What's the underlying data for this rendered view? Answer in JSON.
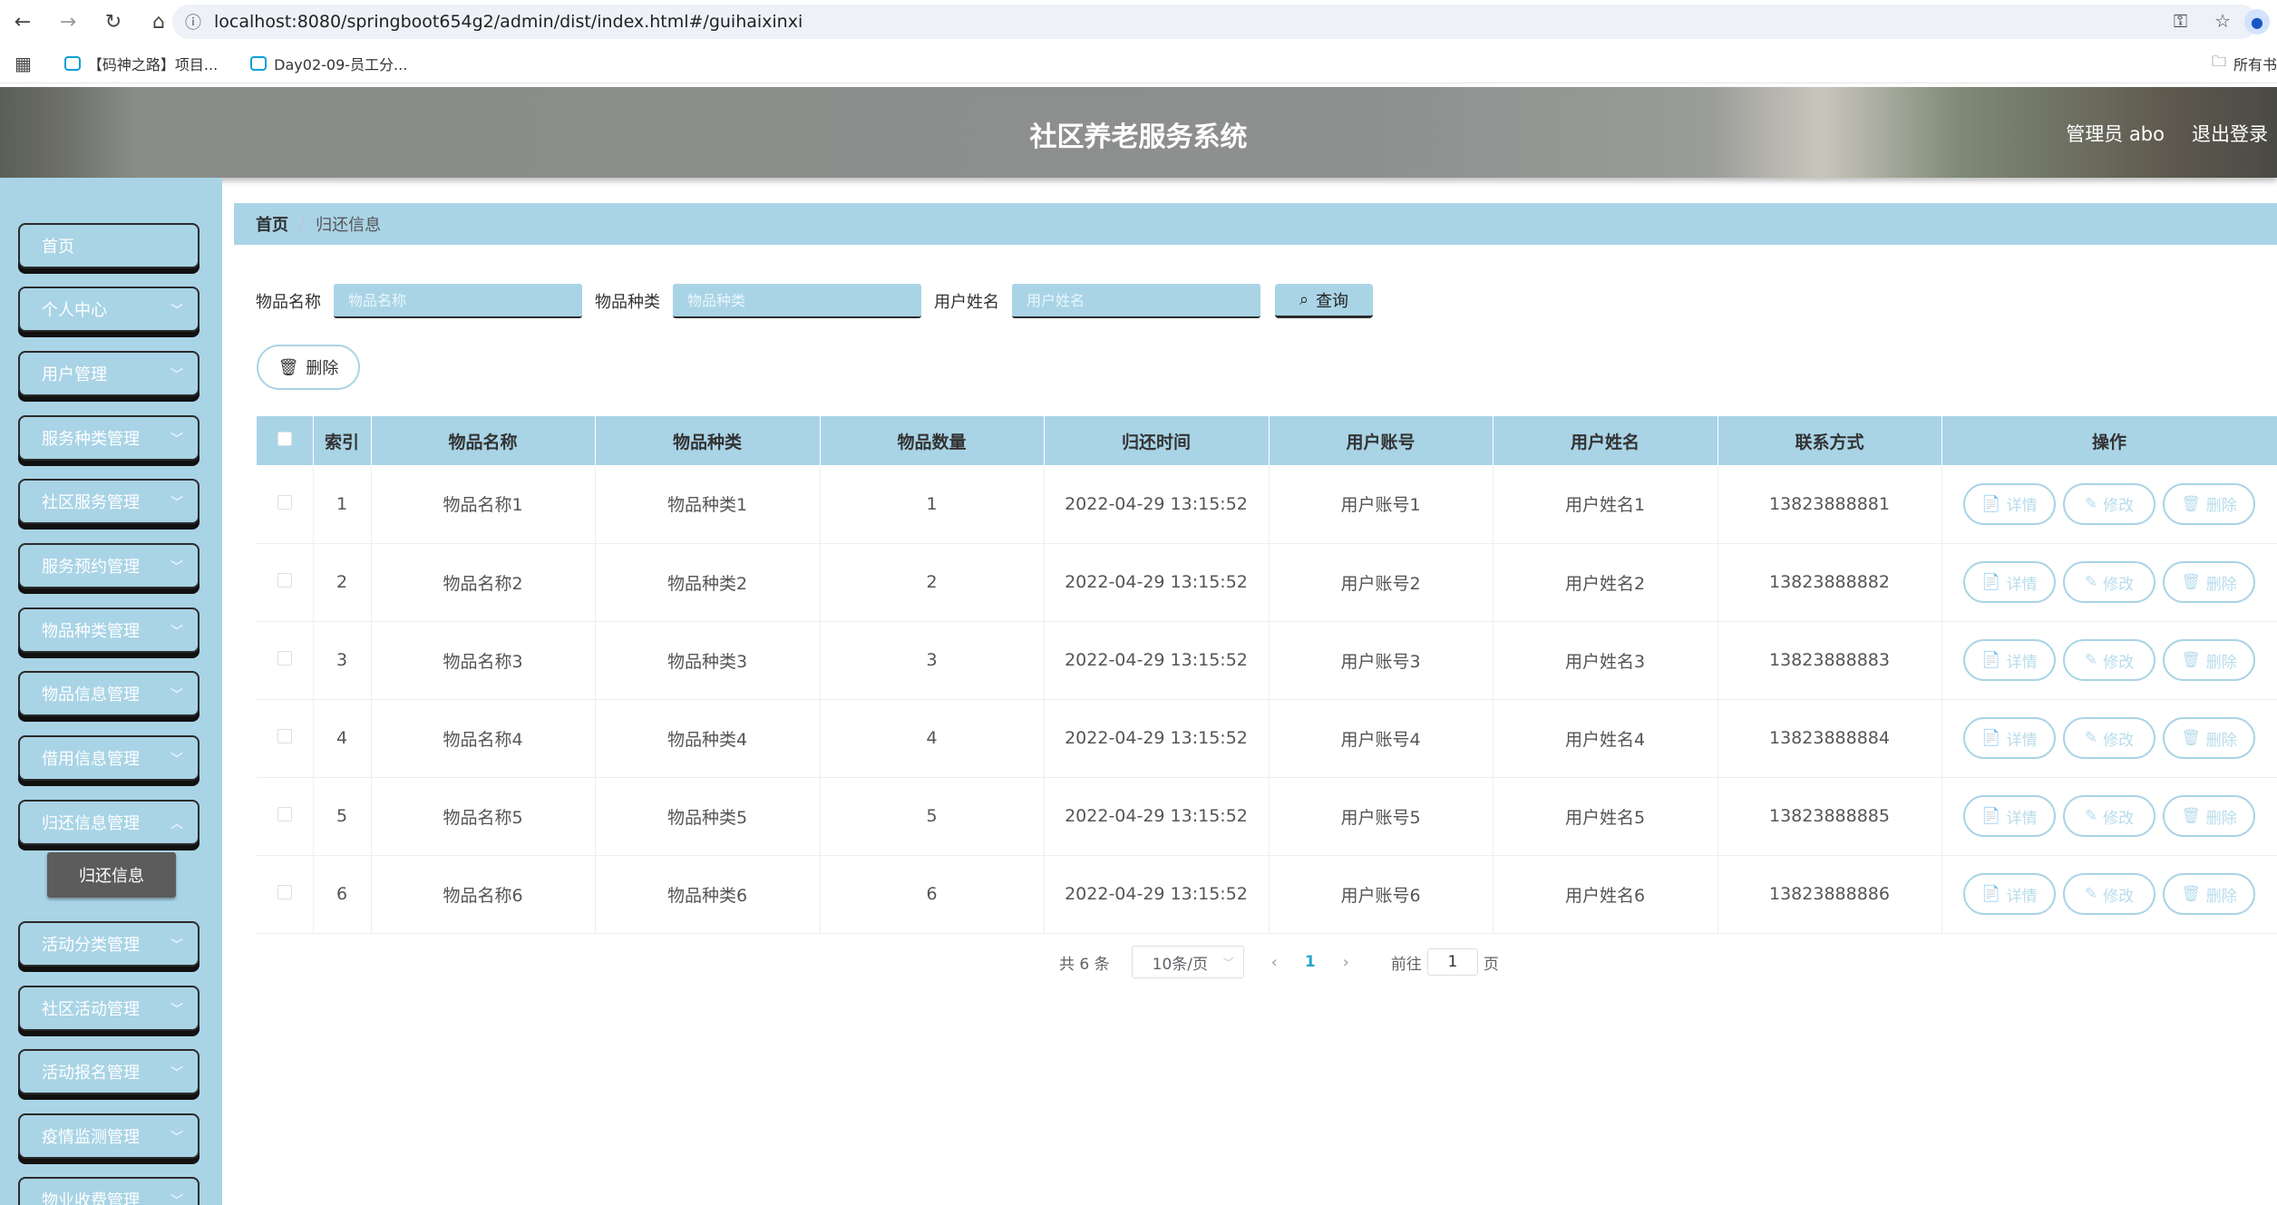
{
  "browser": {
    "url": "localhost:8080/springboot654g2/admin/dist/index.html#/guihaixinxi",
    "bookmarks": [
      "【码神之路】项目...",
      "Day02-09-员工分..."
    ],
    "bookmarks_right": "所有书"
  },
  "header": {
    "title": "社区养老服务系统",
    "user": "管理员 abo",
    "logout": "退出登录"
  },
  "sidebar": {
    "items": [
      {
        "label": "首页",
        "has_children": false
      },
      {
        "label": "个人中心",
        "has_children": true
      },
      {
        "label": "用户管理",
        "has_children": true
      },
      {
        "label": "服务种类管理",
        "has_children": true
      },
      {
        "label": "社区服务管理",
        "has_children": true
      },
      {
        "label": "服务预约管理",
        "has_children": true
      },
      {
        "label": "物品种类管理",
        "has_children": true
      },
      {
        "label": "物品信息管理",
        "has_children": true
      },
      {
        "label": "借用信息管理",
        "has_children": true
      },
      {
        "label": "归还信息管理",
        "has_children": true
      },
      {
        "label": "活动分类管理",
        "has_children": true
      },
      {
        "label": "社区活动管理",
        "has_children": true
      },
      {
        "label": "活动报名管理",
        "has_children": true
      },
      {
        "label": "疫情监测管理",
        "has_children": true
      },
      {
        "label": "物业收费管理",
        "has_children": true
      }
    ],
    "active_sub": "归还信息"
  },
  "breadcrumb": {
    "home": "首页",
    "current": "归还信息"
  },
  "search": {
    "fields": [
      {
        "label": "物品名称",
        "placeholder": "物品名称"
      },
      {
        "label": "物品种类",
        "placeholder": "物品种类"
      },
      {
        "label": "用户姓名",
        "placeholder": "用户姓名"
      }
    ],
    "query_label": "查询"
  },
  "toolbar": {
    "delete_label": "删除"
  },
  "table": {
    "columns": [
      "索引",
      "物品名称",
      "物品种类",
      "物品数量",
      "归还时间",
      "用户账号",
      "用户姓名",
      "联系方式",
      "操作"
    ],
    "rows": [
      [
        "1",
        "物品名称1",
        "物品种类1",
        "1",
        "2022-04-29 13:15:52",
        "用户账号1",
        "用户姓名1",
        "13823888881"
      ],
      [
        "2",
        "物品名称2",
        "物品种类2",
        "2",
        "2022-04-29 13:15:52",
        "用户账号2",
        "用户姓名2",
        "13823888882"
      ],
      [
        "3",
        "物品名称3",
        "物品种类3",
        "3",
        "2022-04-29 13:15:52",
        "用户账号3",
        "用户姓名3",
        "13823888883"
      ],
      [
        "4",
        "物品名称4",
        "物品种类4",
        "4",
        "2022-04-29 13:15:52",
        "用户账号4",
        "用户姓名4",
        "13823888884"
      ],
      [
        "5",
        "物品名称5",
        "物品种类5",
        "5",
        "2022-04-29 13:15:52",
        "用户账号5",
        "用户姓名5",
        "13823888885"
      ],
      [
        "6",
        "物品名称6",
        "物品种类6",
        "6",
        "2022-04-29 13:15:52",
        "用户账号6",
        "用户姓名6",
        "13823888886"
      ]
    ],
    "actions": [
      "详情",
      "修改",
      "删除"
    ]
  },
  "pagination": {
    "total": "共 6 条",
    "page_size": "10条/页",
    "current_page": "1",
    "goto_label": "前往",
    "goto_value": "1",
    "page_suffix": "页"
  },
  "colors": {
    "accent": "#a9d4e6",
    "active_sub": "#5c5c5c",
    "page_link": "#2aa7c9"
  }
}
